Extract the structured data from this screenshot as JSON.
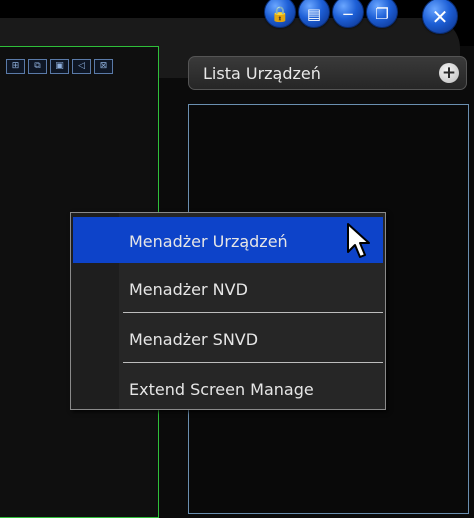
{
  "window_controls": [
    {
      "name": "lock-icon",
      "glyph": "🔒"
    },
    {
      "name": "document-icon",
      "glyph": "▤"
    },
    {
      "name": "minimize-icon",
      "glyph": "−"
    },
    {
      "name": "restore-icon",
      "glyph": "❐"
    },
    {
      "name": "close-icon",
      "glyph": "✕"
    }
  ],
  "video_toolbar": [
    {
      "name": "layout-icon",
      "glyph": "⊞"
    },
    {
      "name": "snapshot-icon",
      "glyph": "⧉"
    },
    {
      "name": "record-icon",
      "glyph": "▣"
    },
    {
      "name": "audio-icon",
      "glyph": "◁"
    },
    {
      "name": "close-view-icon",
      "glyph": "⊠"
    }
  ],
  "device_list": {
    "title": "Lista Urządzeń",
    "add_glyph": "+"
  },
  "context_menu": {
    "items": [
      {
        "label": "Menadżer Urządzeń",
        "selected": true
      },
      {
        "label": "Menadżer NVD",
        "selected": false
      },
      {
        "label": "Menadżer SNVD",
        "selected": false
      },
      {
        "label": "Extend Screen Manage",
        "selected": false
      }
    ]
  },
  "colors": {
    "menu_highlight": "#0d43c9",
    "pane_border": "#2fbf3a",
    "list_border": "#6a8fb0",
    "button_blue": "#1d5fd6"
  }
}
